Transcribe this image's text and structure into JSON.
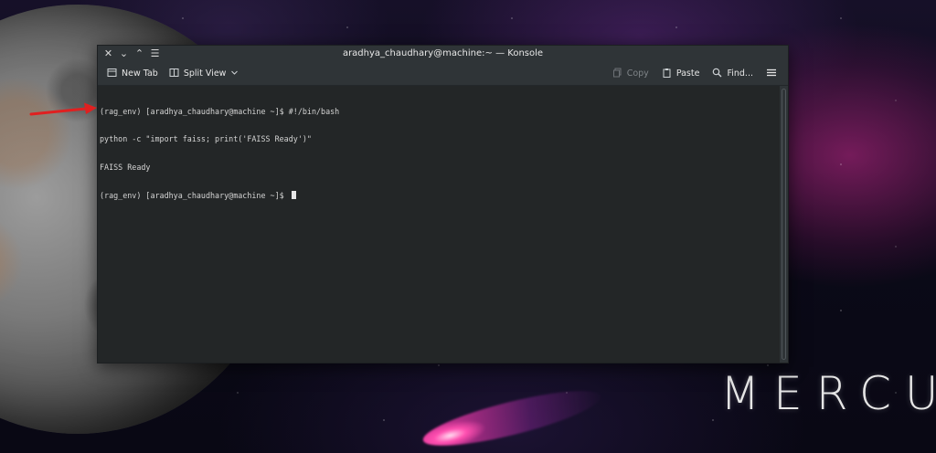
{
  "wallpaper": {
    "label": "MERCURY",
    "accent": "#ff3fa8"
  },
  "window": {
    "title": "aradhya_chaudhary@machine:~ — Konsole"
  },
  "titlebar": {
    "controls": [
      "✕",
      "⌄",
      "⌃",
      "☰"
    ]
  },
  "toolbar": {
    "new_tab": "New Tab",
    "split_view": "Split View",
    "copy": "Copy",
    "paste": "Paste",
    "find": "Find..."
  },
  "terminal": {
    "lines": [
      "(rag_env) [aradhya_chaudhary@machine ~]$ #!/bin/bash",
      "python -c \"import faiss; print('FAISS Ready')\"",
      "FAISS Ready",
      "(rag_env) [aradhya_chaudhary@machine ~]$ "
    ]
  },
  "annotation": {
    "arrow_color": "#e02020"
  }
}
